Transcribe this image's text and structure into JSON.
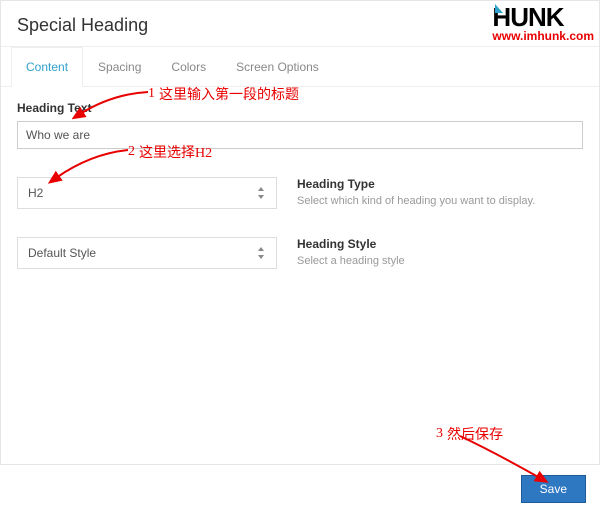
{
  "title": "Special Heading",
  "tabs": {
    "content": "Content",
    "spacing": "Spacing",
    "colors": "Colors",
    "screen_options": "Screen Options"
  },
  "heading_text": {
    "label": "Heading Text",
    "value": "Who we are"
  },
  "heading_type": {
    "value": "H2",
    "label": "Heading Type",
    "desc": "Select which kind of heading you want to display."
  },
  "heading_style": {
    "value": "Default Style",
    "label": "Heading Style",
    "desc": "Select a heading style"
  },
  "save_label": "Save",
  "annotations": {
    "a1": {
      "num": "1",
      "text": "这里输入第一段的标题"
    },
    "a2": {
      "num": "2",
      "text": "这里选择H2"
    },
    "a3": {
      "num": "3",
      "text": "然后保存"
    }
  },
  "logo": {
    "text": "HUNK",
    "url": "www.imhunk.com"
  }
}
